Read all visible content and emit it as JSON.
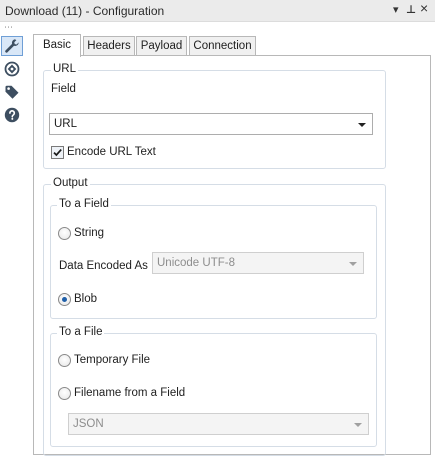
{
  "window": {
    "title": "Download (11) - Configuration",
    "controls": {
      "dropdown_glyph": "▾",
      "pin_glyph": "⊥",
      "close_glyph": "×"
    }
  },
  "sidebar": {
    "overflow_glyph": "⋯",
    "items": [
      {
        "icon": "wrench-icon",
        "active": true
      },
      {
        "icon": "connection-icon",
        "active": false
      },
      {
        "icon": "tag-icon",
        "active": false
      },
      {
        "icon": "help-icon",
        "active": false
      }
    ]
  },
  "tabs": [
    {
      "label": "Basic",
      "active": true
    },
    {
      "label": "Headers",
      "active": false
    },
    {
      "label": "Payload",
      "active": false
    },
    {
      "label": "Connection",
      "active": false
    }
  ],
  "url_group": {
    "title": "URL",
    "field_label": "Field",
    "field_value": "URL",
    "encode_label": "Encode URL Text",
    "encode_checked": true
  },
  "output_group": {
    "title": "Output",
    "to_field": {
      "title": "To a Field",
      "string_label": "String",
      "encoding_label": "Data Encoded As",
      "encoding_value": "Unicode UTF-8",
      "blob_label": "Blob",
      "selected": "blob"
    },
    "to_file": {
      "title": "To a File",
      "temp_label": "Temporary File",
      "filename_label": "Filename from a Field",
      "filename_value": "JSON"
    }
  },
  "colors": {
    "accent": "#1f5fa8",
    "check": "#1a1a1a",
    "border": "#d5dde6",
    "tab_border": "#b8b8b8"
  }
}
